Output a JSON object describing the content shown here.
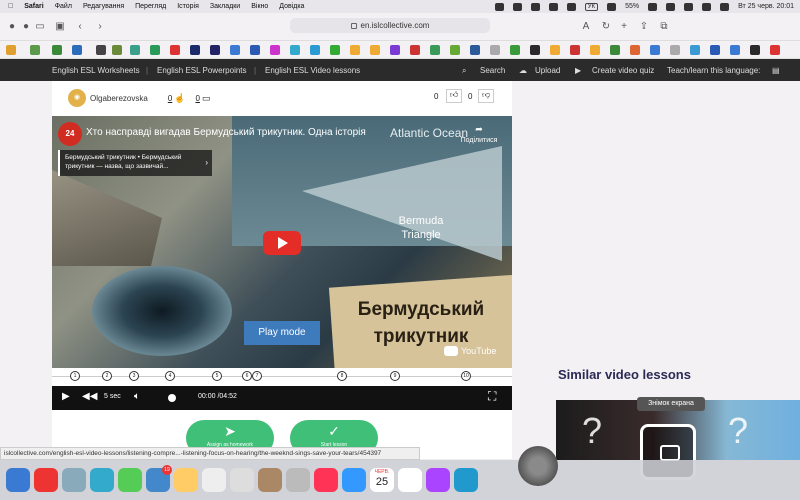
{
  "menubar": {
    "items": [
      "Safari",
      "Файл",
      "Редагування",
      "Перегляд",
      "Історія",
      "Закладки",
      "Вікно",
      "Довідка"
    ],
    "battery": "55%",
    "keyboard": "УК",
    "datetime": "Вт 25 черв.  20:01"
  },
  "browser": {
    "url": "en.islcollective.com"
  },
  "sitenav": {
    "links": [
      "English ESL Worksheets",
      "English ESL Powerpoints",
      "English ESL Video lessons"
    ],
    "search": "Search",
    "upload": "Upload",
    "create": "Create video quiz",
    "teach": "Teach/learn this language:"
  },
  "lesson": {
    "author": "Olgaberezovska",
    "likes_left": "0",
    "comments": "0",
    "likes": "0",
    "dislikes": "0"
  },
  "video": {
    "channel": "24",
    "title": "Хто насправді вигадав Бермудський трикутник. Одна історія",
    "share": "Поділитися",
    "tooltip": "Бермудський трикутник • Бермудський трикутник — назва, що зазвичай...",
    "ocean_label": "Atlantic Ocean",
    "bermuda_label": "Bermuda Triangle",
    "overlay_title_1": "Бермудський",
    "overlay_title_2": "трикутник",
    "play_mode": "Play mode",
    "youtube": "YouTube"
  },
  "timeline": {
    "markers": [
      "1",
      "2",
      "3",
      "4",
      "5",
      "6",
      "7",
      "8",
      "9",
      "10"
    ]
  },
  "controls": {
    "skip": "5 sec",
    "time": "00:00 /04:52"
  },
  "actions": {
    "left_label": "Assign as homework",
    "right_label": "Start lesson"
  },
  "sidebar": {
    "similar_title": "Similar video lessons"
  },
  "screenshot_tool": {
    "tooltip": "Знімок екрана"
  },
  "statusbar": {
    "url": "islcollective.com/english-esl-video-lessons/listening-compre...-listening-focus-on-hearing/the-weeknd-sings-save-your-tears/454397"
  },
  "dock": {
    "mail_badge": "19",
    "calendar_month": "ЧЕРВ.",
    "calendar_day": "25"
  }
}
